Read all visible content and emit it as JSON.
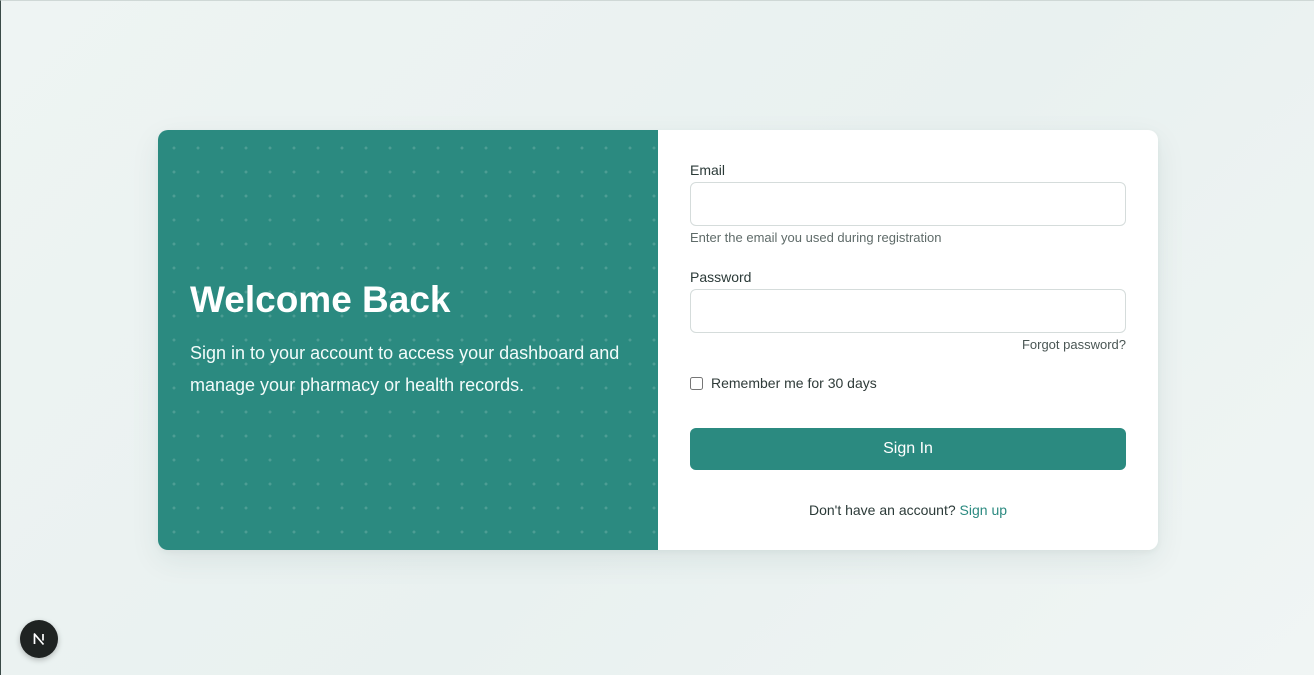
{
  "hero": {
    "title": "Welcome Back",
    "subtitle": "Sign in to your account to access your dashboard and manage your pharmacy or health records."
  },
  "form": {
    "email_label": "Email",
    "email_value": "",
    "email_hint": "Enter the email you used during registration",
    "password_label": "Password",
    "password_value": "",
    "forgot_link": "Forgot password?",
    "remember_label": "Remember me for 30 days",
    "remember_checked": false,
    "submit_label": "Sign In",
    "signup_prompt": "Don't have an account?",
    "signup_link": "Sign up"
  },
  "dev_badge": {
    "icon": "nextjs-logo-icon"
  },
  "colors": {
    "accent": "#2b8a80",
    "background": "#eef4f3",
    "card": "#ffffff",
    "text": "#2b3a38"
  }
}
